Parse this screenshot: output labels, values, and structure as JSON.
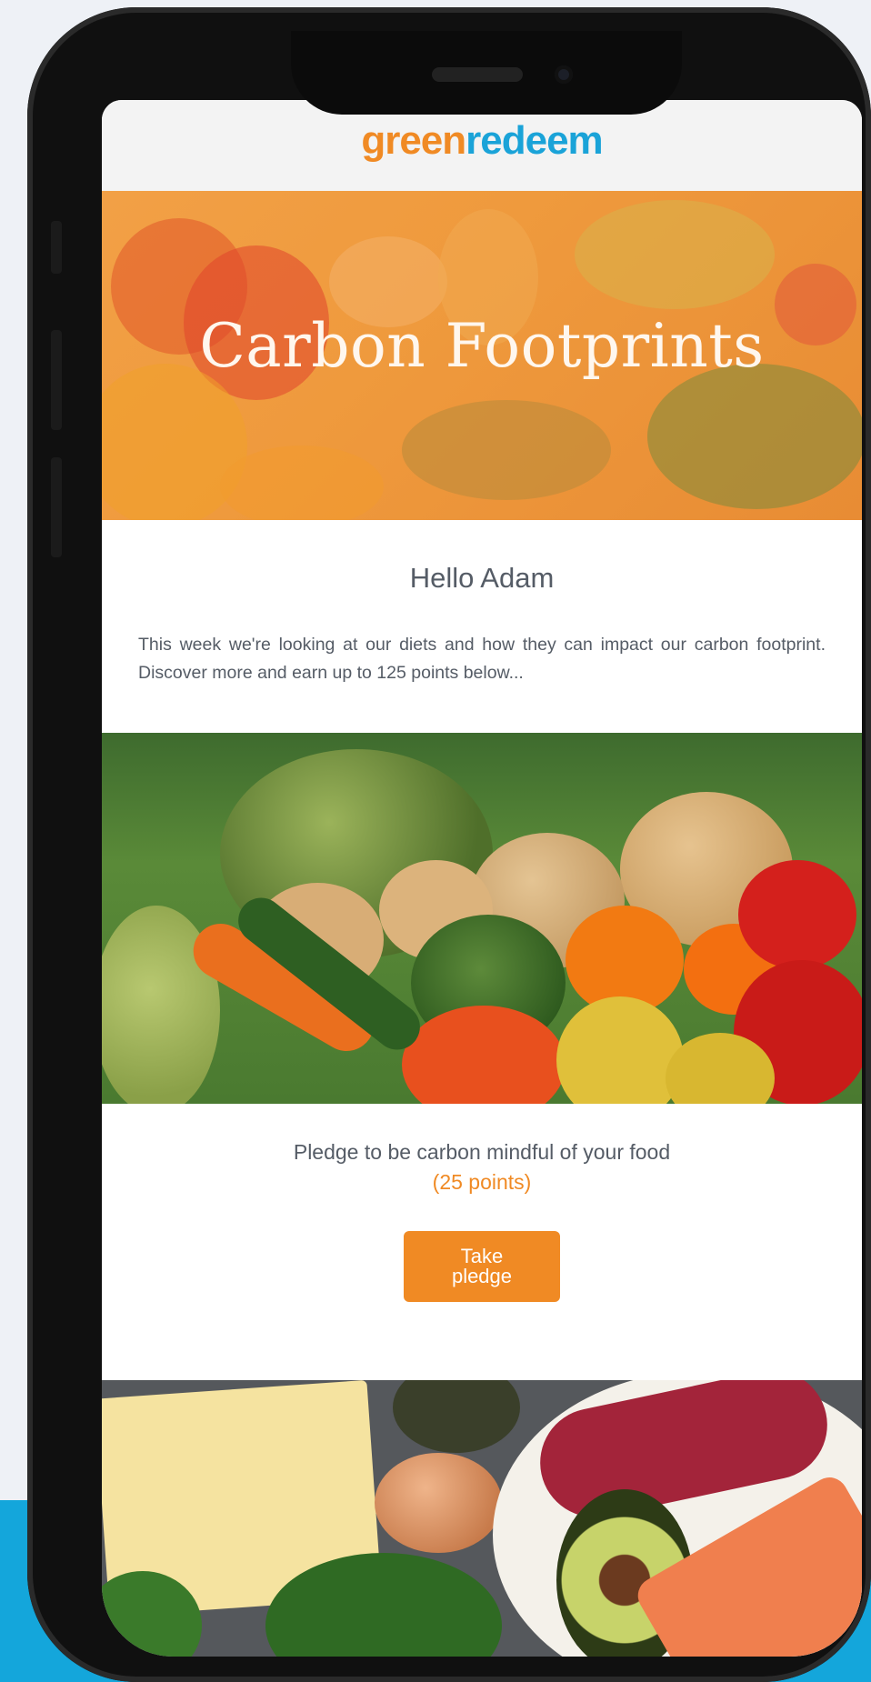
{
  "email": {
    "logo": {
      "part1": "green",
      "part2": "redeem"
    },
    "hero_title": "Carbon Footprints",
    "greeting": "Hello Adam",
    "intro": "This week we're looking at our diets and how they can impact our carbon footprint. Discover more and earn up to 125 points below...",
    "pledge": {
      "text": "Pledge to be carbon mindful of your food",
      "points": "(25 points)",
      "button_line1": "Take",
      "button_line2": "pledge"
    }
  },
  "colors": {
    "brand_orange": "#f08a24",
    "brand_blue": "#1aa3d8",
    "text_gray": "#555c66",
    "background_band": "#14a6db"
  }
}
